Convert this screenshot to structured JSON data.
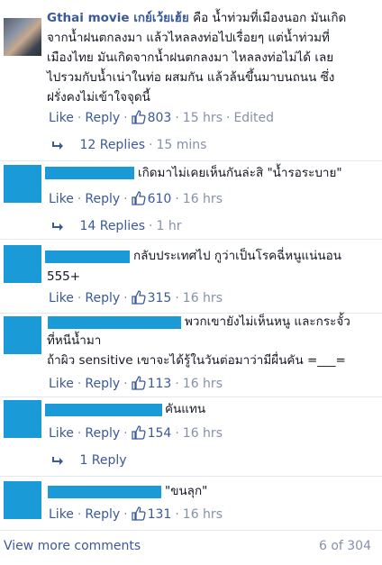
{
  "comments": [
    {
      "author": "Gthai movie เกย์เว้ยเฮ้ย",
      "text_lines": [
        "คือ น้ำท่วมที่เมืองนอก มันเกิด",
        "จากน้ำฝนตกลงมา แล้วไหลลงท่อไปเรื่อยๆ แต่น้ำท่วมที่",
        "เมืองไทย มันเกิดจากน้ำฝนตกลงมา ไหลลงท่อไม่ได้ เลย",
        "ไปรวมกับน้ำเน่าในท่อ ผสมกัน แล้วล้นขึ้นมาบนถนน ซึ่ง",
        "ฝรั่งคงไม่เข้าใจจุดนี้"
      ],
      "like": "Like",
      "reply": "Reply",
      "likes": "803",
      "time": "15 hrs",
      "edited": "Edited",
      "replies_label": "12 Replies",
      "replies_time": "15 mins"
    },
    {
      "text": "เกิดมาไม่เคยเห็นกันล่ะสิ \"น้ำรอระบาย\"",
      "like": "Like",
      "reply": "Reply",
      "likes": "610",
      "time": "16 hrs",
      "replies_label": "14 Replies",
      "replies_time": "1 hr"
    },
    {
      "text_lines": [
        "กลับประเทศไป กูว่าเป็นโรคฉี่หนูแน่นอน",
        "555+"
      ],
      "like": "Like",
      "reply": "Reply",
      "likes": "315",
      "time": "16 hrs"
    },
    {
      "text_lines": [
        "พวกเขายังไม่เห็นหนู และกระจั้ว",
        "ที่หนีน้ำมา",
        "ถ้าผิว sensitive เขาจะได้รู้ในวันต่อมาว่ามีผื่นคัน =___="
      ],
      "like": "Like",
      "reply": "Reply",
      "likes": "113",
      "time": "16 hrs"
    },
    {
      "text": "คันแทน",
      "like": "Like",
      "reply": "Reply",
      "likes": "154",
      "time": "16 hrs",
      "replies_label": "1 Reply"
    },
    {
      "text": "\"ขนลุก\"",
      "like": "Like",
      "reply": "Reply",
      "likes": "131",
      "time": "16 hrs"
    }
  ],
  "footer": {
    "view_more": "View more comments",
    "count": "6 of 304"
  },
  "colors": {
    "link": "#3b5998",
    "meta": "#8591a8",
    "redaction": "#1a9bd7"
  },
  "icons": {
    "like": "thumbs-up-icon",
    "reply_arrow": "reply-arrow-icon"
  }
}
